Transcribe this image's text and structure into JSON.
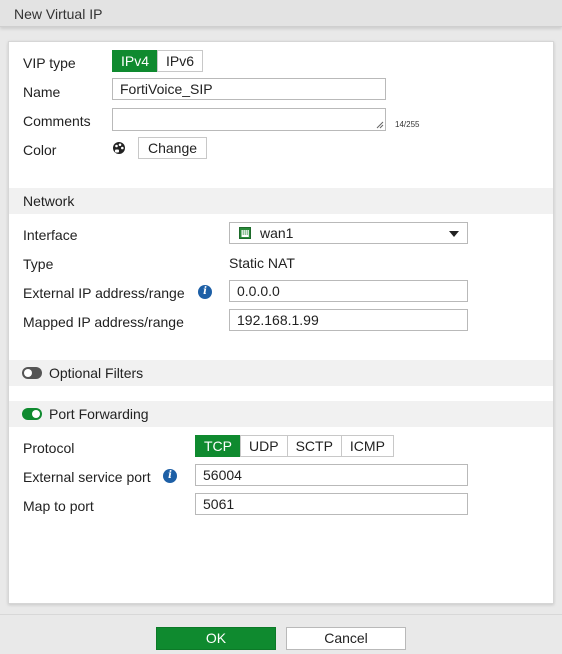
{
  "dialog": {
    "title": "New Virtual IP"
  },
  "vip": {
    "vip_type_label": "VIP type",
    "vip_type_options": [
      "IPv4",
      "IPv6"
    ],
    "vip_type_selected": "IPv4",
    "name_label": "Name",
    "name_value": "FortiVoice_SIP",
    "comments_label": "Comments",
    "comments_value": "",
    "comments_counter": "14/255",
    "color_label": "Color",
    "color_change_label": "Change"
  },
  "network": {
    "section_title": "Network",
    "interface_label": "Interface",
    "interface_value": "wan1",
    "type_label": "Type",
    "type_value": "Static NAT",
    "external_ip_label": "External IP address/range",
    "external_ip_value": "0.0.0.0",
    "mapped_ip_label": "Mapped IP address/range",
    "mapped_ip_value": "192.168.1.99"
  },
  "optional_filters": {
    "label": "Optional Filters",
    "enabled": false
  },
  "port_forwarding": {
    "label": "Port Forwarding",
    "enabled": true,
    "protocol_label": "Protocol",
    "protocol_options": [
      "TCP",
      "UDP",
      "SCTP",
      "ICMP"
    ],
    "protocol_selected": "TCP",
    "external_port_label": "External service port",
    "external_port_value": "56004",
    "map_port_label": "Map to port",
    "map_port_value": "5061"
  },
  "footer": {
    "ok_label": "OK",
    "cancel_label": "Cancel"
  },
  "colors": {
    "accent": "#0f8a2f",
    "info": "#1d5fa6"
  }
}
